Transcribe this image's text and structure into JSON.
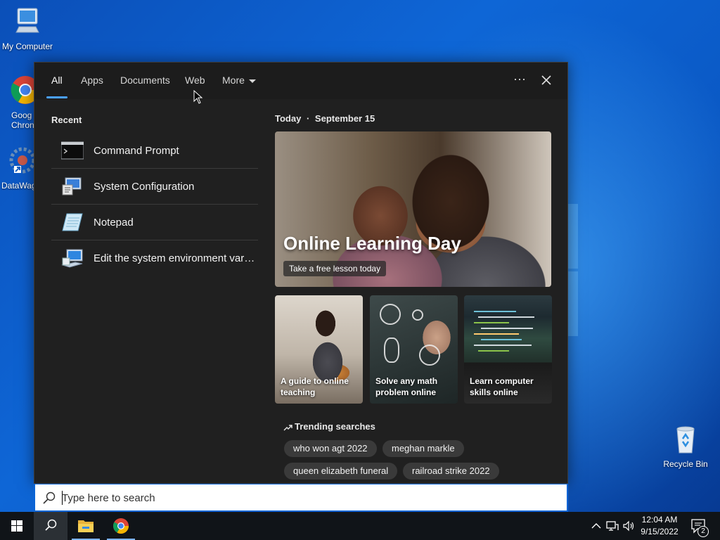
{
  "desktop": {
    "icons": [
      {
        "label": "My Computer"
      },
      {
        "label": "Goog\nChron"
      },
      {
        "label": "DataWag"
      },
      {
        "label": "Recycle Bin"
      }
    ]
  },
  "search_panel": {
    "tabs": [
      {
        "label": "All",
        "active": true
      },
      {
        "label": "Apps"
      },
      {
        "label": "Documents"
      },
      {
        "label": "Web"
      },
      {
        "label": "More"
      }
    ],
    "more_options_glyph": "···",
    "recent": {
      "header": "Recent",
      "items": [
        {
          "label": "Command Prompt",
          "icon": "command-prompt-icon"
        },
        {
          "label": "System Configuration",
          "icon": "system-configuration-icon"
        },
        {
          "label": "Notepad",
          "icon": "notepad-icon"
        },
        {
          "label": "Edit the system environment vari...",
          "icon": "system-properties-icon"
        }
      ]
    },
    "today": {
      "header": "Today",
      "date": "September 15",
      "hero": {
        "title": "Online Learning Day",
        "subtitle": "Take a free lesson today"
      },
      "cards": [
        {
          "label": "A guide to online teaching"
        },
        {
          "label": "Solve any math problem online"
        },
        {
          "label": "Learn computer skills online"
        }
      ]
    },
    "trending": {
      "header": "Trending searches",
      "chips": [
        "who won agt 2022",
        "meghan markle",
        "queen elizabeth funeral",
        "railroad strike 2022"
      ]
    }
  },
  "search_box": {
    "placeholder": "Type here to search",
    "value": ""
  },
  "taskbar": {
    "clock_time": "12:04 AM",
    "clock_date": "9/15/2022",
    "notification_count": "2"
  },
  "colors": {
    "accent": "#4aa0ff",
    "panel_bg": "#202020",
    "taskbar_bg": "#101418",
    "chip_bg": "#3a3a3a"
  }
}
